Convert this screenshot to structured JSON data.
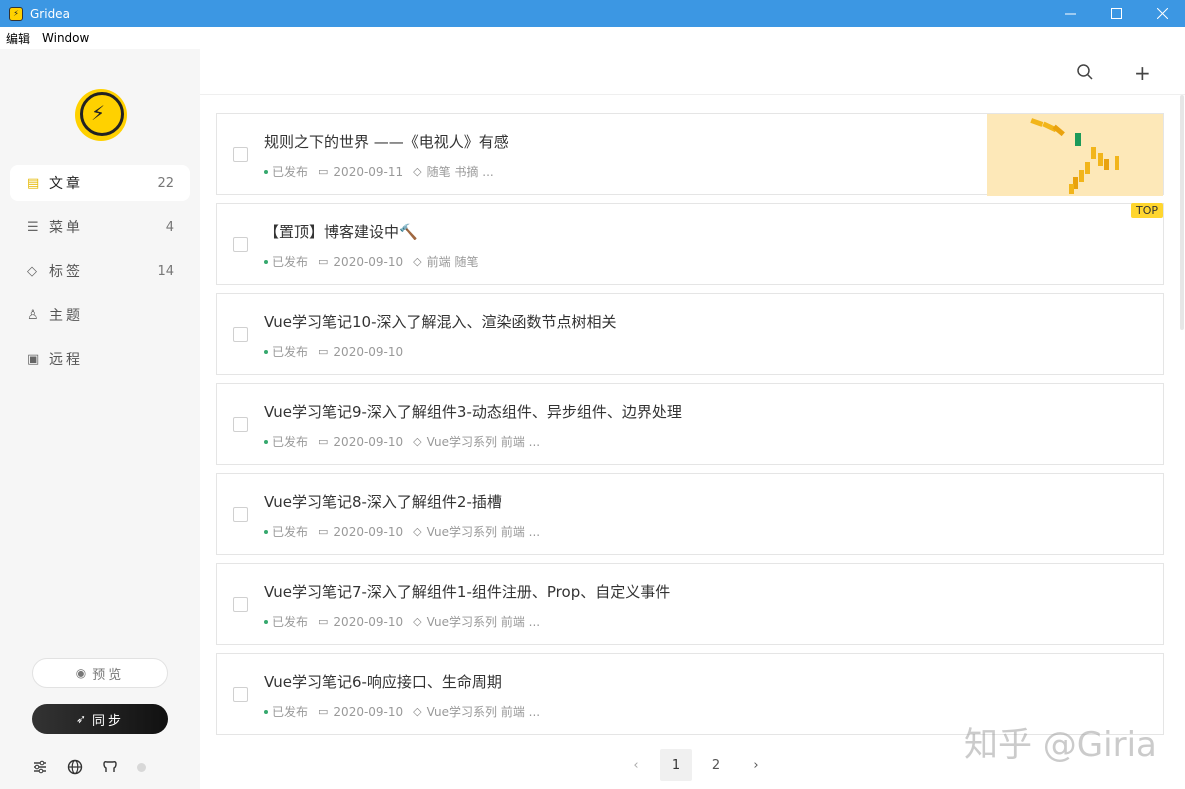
{
  "window": {
    "title": "Gridea"
  },
  "menubar": {
    "items": [
      "编辑",
      "Window"
    ]
  },
  "sidebar": {
    "nav": [
      {
        "icon": "file-text-icon",
        "label": "文章",
        "count": "22",
        "active": true
      },
      {
        "icon": "menu-icon",
        "label": "菜单",
        "count": "4"
      },
      {
        "icon": "tag-icon",
        "label": "标签",
        "count": "14"
      },
      {
        "icon": "shirt-icon",
        "label": "主题",
        "count": ""
      },
      {
        "icon": "server-icon",
        "label": "远程",
        "count": ""
      }
    ],
    "preview_label": "预览",
    "sync_label": "同步"
  },
  "posts": [
    {
      "title": "规则之下的世界 ——《电视人》有感",
      "status": "已发布",
      "date": "2020-09-11",
      "tags": "随笔 书摘 ...",
      "has_thumb": true
    },
    {
      "title": "【置顶】博客建设中🔨",
      "status": "已发布",
      "date": "2020-09-10",
      "tags": "前端 随笔",
      "top": "TOP"
    },
    {
      "title": "Vue学习笔记10-深入了解混入、渲染函数节点树相关",
      "status": "已发布",
      "date": "2020-09-10",
      "tags": ""
    },
    {
      "title": "Vue学习笔记9-深入了解组件3-动态组件、异步组件、边界处理",
      "status": "已发布",
      "date": "2020-09-10",
      "tags": "Vue学习系列 前端 ..."
    },
    {
      "title": "Vue学习笔记8-深入了解组件2-插槽",
      "status": "已发布",
      "date": "2020-09-10",
      "tags": "Vue学习系列 前端 ..."
    },
    {
      "title": "Vue学习笔记7-深入了解组件1-组件注册、Prop、自定义事件",
      "status": "已发布",
      "date": "2020-09-10",
      "tags": "Vue学习系列 前端 ..."
    },
    {
      "title": "Vue学习笔记6-响应接口、生命周期",
      "status": "已发布",
      "date": "2020-09-10",
      "tags": "Vue学习系列 前端 ..."
    }
  ],
  "pagination": {
    "pages": [
      "1",
      "2"
    ],
    "current": "1"
  },
  "watermark": "知乎 @Giria"
}
